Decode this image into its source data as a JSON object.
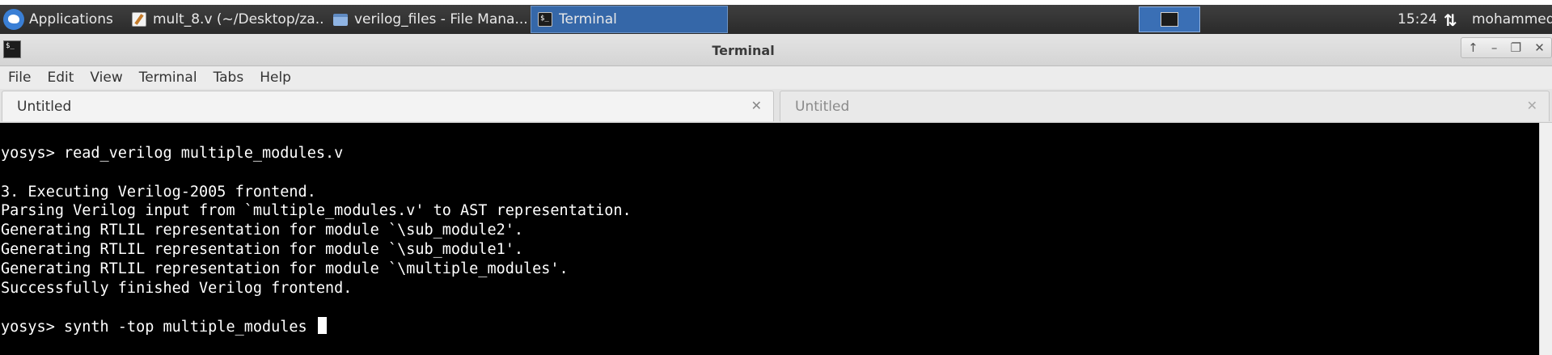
{
  "taskbar": {
    "applications_label": "Applications",
    "windows": [
      {
        "label": "mult_8.v (~/Desktop/za...",
        "icon": "text-editor-icon"
      },
      {
        "label": "verilog_files - File Mana...",
        "icon": "folder-icon"
      },
      {
        "label": "Terminal",
        "icon": "terminal-icon"
      }
    ],
    "clock": "15:24",
    "user": "mohammed"
  },
  "window": {
    "title": "Terminal",
    "controls": [
      "↑",
      "–",
      "❐",
      "✕"
    ]
  },
  "menu": [
    "File",
    "Edit",
    "View",
    "Terminal",
    "Tabs",
    "Help"
  ],
  "tabs": [
    {
      "label": "Untitled",
      "active": true
    },
    {
      "label": "Untitled",
      "active": false
    }
  ],
  "terminal": {
    "lines": [
      "yosys> read_verilog multiple_modules.v",
      "",
      "3. Executing Verilog-2005 frontend.",
      "Parsing Verilog input from `multiple_modules.v' to AST representation.",
      "Generating RTLIL representation for module `\\sub_module2'.",
      "Generating RTLIL representation for module `\\sub_module1'.",
      "Generating RTLIL representation for module `\\multiple_modules'.",
      "Successfully finished Verilog frontend.",
      "",
      "yosys> synth -top multiple_modules "
    ]
  },
  "colors": {
    "taskbar_bg": "#2f2f2f",
    "active_window": "#3567a8",
    "terminal_bg": "#000000",
    "terminal_fg": "#ffffff"
  }
}
